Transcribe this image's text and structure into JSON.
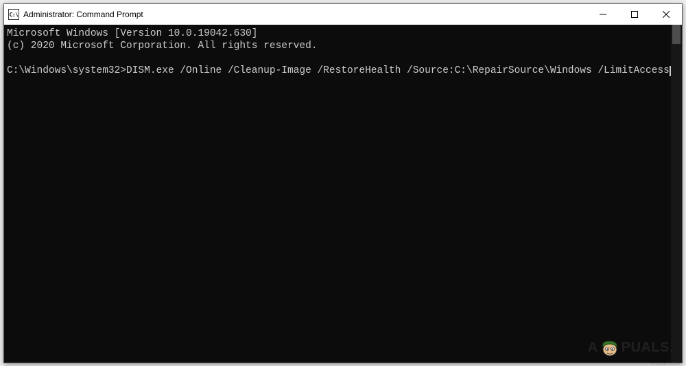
{
  "titlebar": {
    "icon_label": "C:\\",
    "title": "Administrator: Command Prompt"
  },
  "terminal": {
    "line1": "Microsoft Windows [Version 10.0.19042.630]",
    "line2": "(c) 2020 Microsoft Corporation. All rights reserved.",
    "blank": "",
    "prompt": "C:\\Windows\\system32>",
    "command": "DISM.exe /Online /Cleanup-Image /RestoreHealth /Source:C:\\RepairSource\\Windows /LimitAccess"
  },
  "watermark": {
    "prefix": "A",
    "suffix": "PUALS."
  },
  "source_note": "wsxdn.com"
}
